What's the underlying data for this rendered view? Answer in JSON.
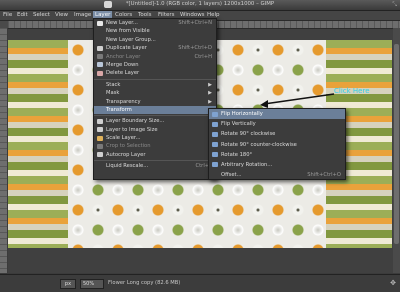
{
  "window": {
    "title": "*[Untitled]-1.0 (RGB color, 1 layers) 1200x1000 – GIMP"
  },
  "menubar": {
    "items": [
      {
        "label": "File",
        "active": false
      },
      {
        "label": "Edit",
        "active": false
      },
      {
        "label": "Select",
        "active": false
      },
      {
        "label": "View",
        "active": false
      },
      {
        "label": "Image",
        "active": false
      },
      {
        "label": "Layer",
        "active": true
      },
      {
        "label": "Colors",
        "active": false
      },
      {
        "label": "Tools",
        "active": false
      },
      {
        "label": "Filters",
        "active": false
      },
      {
        "label": "Windows",
        "active": false
      },
      {
        "label": "Help",
        "active": false
      }
    ]
  },
  "layer_menu": {
    "items": [
      {
        "label": "New Layer...",
        "shortcut": "Shift+Ctrl+N",
        "icon": "new-layer-icon",
        "dim": false
      },
      {
        "label": "New from Visible",
        "shortcut": "",
        "icon": "",
        "dim": false
      },
      {
        "label": "New Layer Group...",
        "shortcut": "",
        "icon": "",
        "dim": false
      },
      {
        "label": "Duplicate Layer",
        "shortcut": "Shift+Ctrl+D",
        "icon": "duplicate-layer-icon",
        "dim": false
      },
      {
        "label": "Anchor Layer",
        "shortcut": "Ctrl+H",
        "icon": "anchor-icon",
        "dim": true
      },
      {
        "label": "Merge Down",
        "shortcut": "",
        "icon": "merge-icon",
        "dim": false
      },
      {
        "label": "Delete Layer",
        "shortcut": "",
        "icon": "delete-icon",
        "dim": false
      },
      {
        "sep": true
      },
      {
        "label": "Stack",
        "submenu": true
      },
      {
        "label": "Mask",
        "submenu": true
      },
      {
        "label": "Transparency",
        "submenu": true
      },
      {
        "label": "Transform",
        "submenu": true,
        "highlighted": true
      },
      {
        "sep": true
      },
      {
        "label": "Layer Boundary Size...",
        "shortcut": "",
        "icon": "boundary-icon",
        "dim": false
      },
      {
        "label": "Layer to Image Size",
        "shortcut": "",
        "icon": "layer-to-image-icon",
        "dim": false
      },
      {
        "label": "Scale Layer...",
        "shortcut": "",
        "icon": "scale-icon",
        "dim": false
      },
      {
        "label": "Crop to Selection",
        "shortcut": "",
        "icon": "crop-icon",
        "dim": true
      },
      {
        "label": "Autocrop Layer",
        "shortcut": "",
        "icon": "autocrop-icon",
        "dim": false
      },
      {
        "sep": true
      },
      {
        "label": "Liquid Rescale...",
        "shortcut": "Ctrl+L",
        "icon": "",
        "dim": false
      }
    ]
  },
  "transform_submenu": {
    "items": [
      {
        "label": "Flip Horizontally",
        "shortcut": "",
        "highlighted": true
      },
      {
        "label": "Flip Vertically",
        "shortcut": "",
        "highlighted": false
      },
      {
        "label": "Rotate 90° clockwise",
        "shortcut": "",
        "highlighted": false
      },
      {
        "label": "Rotate 90° counter-clockwise",
        "shortcut": "",
        "highlighted": false
      },
      {
        "label": "Rotate 180°",
        "shortcut": "",
        "highlighted": false
      },
      {
        "label": "Arbitrary Rotation...",
        "shortcut": "",
        "highlighted": false
      },
      {
        "label": "Offset...",
        "shortcut": "Shift+Ctrl+O",
        "highlighted": false
      }
    ]
  },
  "annotation": {
    "text": "Click Here",
    "color": "#2fd0e8"
  },
  "statusbar": {
    "pointer": "",
    "unit": "px",
    "zoom": "50%",
    "message": "Flower Long copy (82.6 MB)"
  },
  "colors": {
    "menu_highlight": "#6b7f99",
    "dot_orange": "#e59a2e",
    "dot_green": "#8aa24a"
  }
}
